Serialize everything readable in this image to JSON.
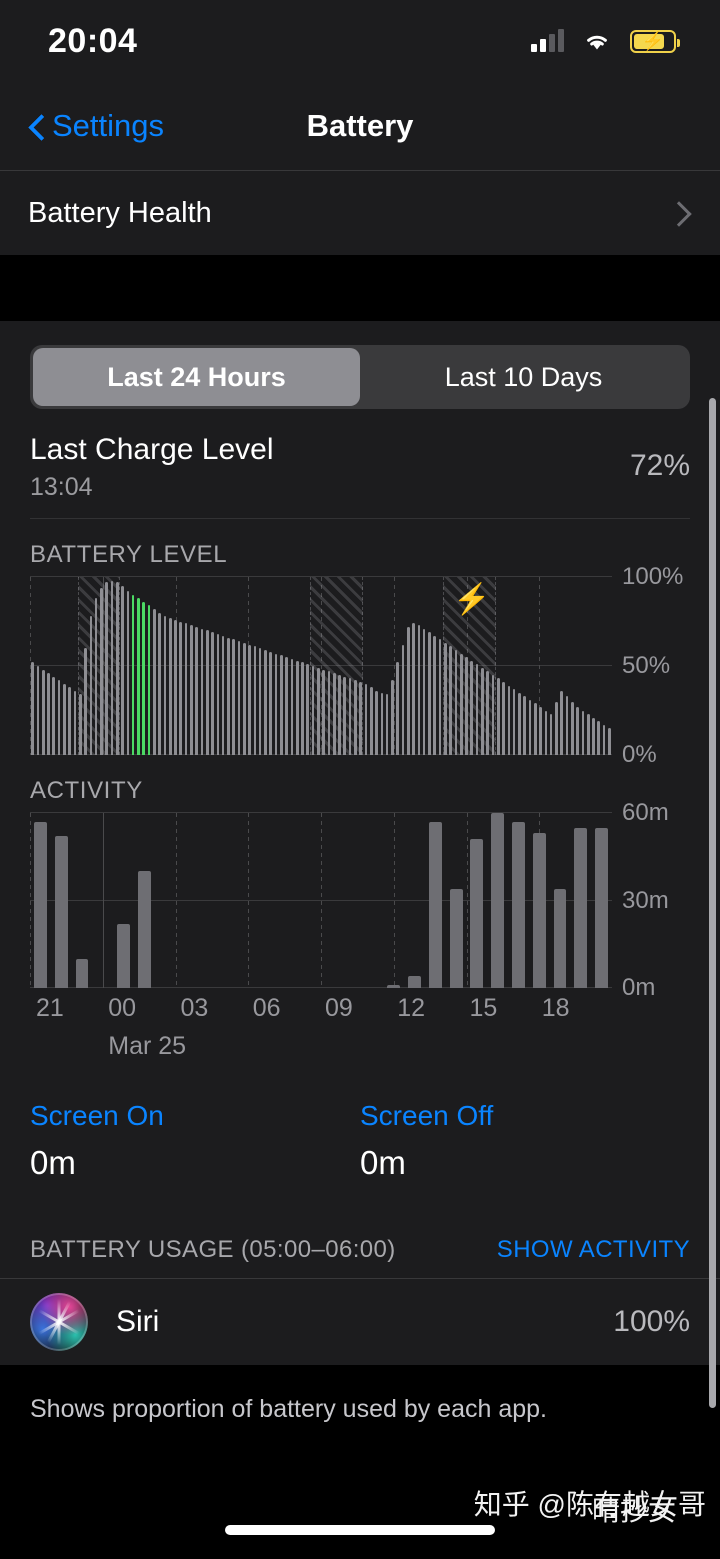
{
  "status_bar": {
    "time": "20:04",
    "icons": [
      "cellular-signal-icon",
      "wifi-icon",
      "battery-charging-icon"
    ]
  },
  "nav": {
    "back_label": "Settings",
    "title": "Battery"
  },
  "battery_health_row": {
    "label": "Battery Health",
    "disclosure": "chevron-right-icon"
  },
  "segmented": {
    "options": [
      "Last 24 Hours",
      "Last 10 Days"
    ],
    "selected_index": 0
  },
  "last_charge": {
    "title": "Last Charge Level",
    "time": "13:04",
    "percent": "72%"
  },
  "battery_level_section": {
    "label": "BATTERY LEVEL"
  },
  "activity_section": {
    "label": "ACTIVITY"
  },
  "screen_stats": {
    "on_label": "Screen On",
    "on_value": "0m",
    "off_label": "Screen Off",
    "off_value": "0m"
  },
  "usage": {
    "header": "BATTERY USAGE (05:00–06:00)",
    "action": "SHOW ACTIVITY",
    "apps": [
      {
        "name": "Siri",
        "percent": "100%",
        "icon": "siri-icon"
      }
    ]
  },
  "footer": {
    "note": "Shows proportion of battery used by each app."
  },
  "watermark": {
    "prefix": "知乎 @",
    "name_a": "陈有越女哥",
    "name_b": "晴抄女"
  },
  "colors": {
    "accent_blue": "#0a84ff",
    "highlight_green": "#4cd964",
    "bar_gray": "#8e8e93",
    "background": "#1c1c1e",
    "battery_yellow": "#f5d84e"
  },
  "chart_data": [
    {
      "type": "bar",
      "id": "battery-level-chart",
      "title": "BATTERY LEVEL",
      "ylabel": "",
      "ylim": [
        0,
        100
      ],
      "yticks": [
        0,
        50,
        100
      ],
      "ytick_labels": [
        "0%",
        "50%",
        "100%"
      ],
      "xlabel": "",
      "x_tick_labels": [
        "21",
        "00",
        "03",
        "06",
        "09",
        "12",
        "15",
        "18"
      ],
      "x_date_label": "Mar 25",
      "grid": true,
      "highlight_color": "#4cd964",
      "bar_color": "#8e8e93",
      "highlighted_indices": [
        19,
        20,
        21,
        22
      ],
      "charging_bands": [
        {
          "start_index": 9,
          "end_index": 16
        },
        {
          "start_index": 53,
          "end_index": 62
        },
        {
          "start_index": 78,
          "end_index": 87
        }
      ],
      "charging_bolt_index": 80,
      "values": [
        52,
        50,
        48,
        46,
        44,
        42,
        40,
        38,
        36,
        34,
        60,
        78,
        88,
        94,
        97,
        98,
        97,
        95,
        92,
        90,
        88,
        86,
        84,
        82,
        80,
        78,
        77,
        76,
        75,
        74,
        73,
        72,
        71,
        70,
        69,
        68,
        67,
        66,
        65,
        64,
        63,
        62,
        61,
        60,
        59,
        58,
        57,
        56,
        55,
        54,
        53,
        52,
        51,
        50,
        49,
        48,
        47,
        46,
        45,
        44,
        43,
        42,
        41,
        40,
        38,
        36,
        35,
        34,
        42,
        52,
        62,
        72,
        74,
        73,
        71,
        69,
        67,
        65,
        63,
        61,
        59,
        57,
        55,
        53,
        51,
        49,
        47,
        45,
        43,
        41,
        39,
        37,
        35,
        33,
        31,
        29,
        27,
        25,
        23,
        30,
        36,
        33,
        30,
        27,
        25,
        23,
        21,
        19,
        17,
        15
      ]
    },
    {
      "type": "bar",
      "id": "activity-chart",
      "title": "ACTIVITY",
      "ylabel": "",
      "ylim": [
        0,
        60
      ],
      "yticks": [
        0,
        30,
        60
      ],
      "ytick_labels": [
        "0m",
        "30m",
        "60m"
      ],
      "xlabel": "",
      "x_tick_labels": [
        "21",
        "00",
        "03",
        "06",
        "09",
        "12",
        "15",
        "18"
      ],
      "x_date_label": "Mar 25",
      "grid": true,
      "bar_color": "#6e6e73",
      "unit": "m",
      "values": [
        57,
        52,
        10,
        0,
        22,
        40,
        0,
        0,
        0,
        0,
        0,
        0,
        0,
        0,
        0,
        0,
        0,
        1,
        4,
        57,
        34,
        51,
        60,
        57,
        53,
        34,
        55,
        55
      ]
    }
  ]
}
